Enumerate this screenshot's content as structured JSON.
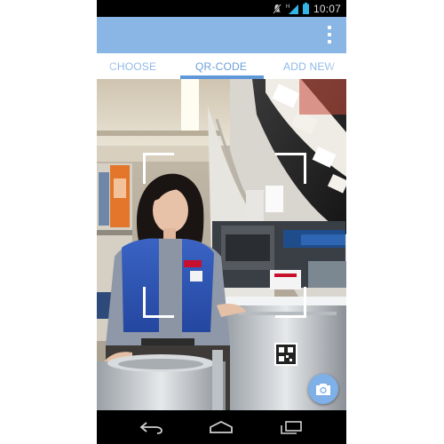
{
  "status_bar": {
    "time": "10:07",
    "icons": [
      "mute-icon",
      "signal-h-icon",
      "battery-icon"
    ]
  },
  "action_bar": {
    "overflow_icon": "overflow-menu-icon"
  },
  "tabs": [
    {
      "label": "CHOOSE",
      "selected": false
    },
    {
      "label": "QR-CODE",
      "selected": true
    },
    {
      "label": "ADD NEW",
      "selected": false
    }
  ],
  "camera": {
    "fab_icon": "camera-icon"
  },
  "nav_bar": {
    "icons": [
      "back-icon",
      "home-icon",
      "recents-icon"
    ]
  },
  "colors": {
    "action_bar": "#8ab6e6",
    "tab_text": "#8fb8e6",
    "tab_indicator": "#5f97d8",
    "fab": "#7fb0e8"
  }
}
